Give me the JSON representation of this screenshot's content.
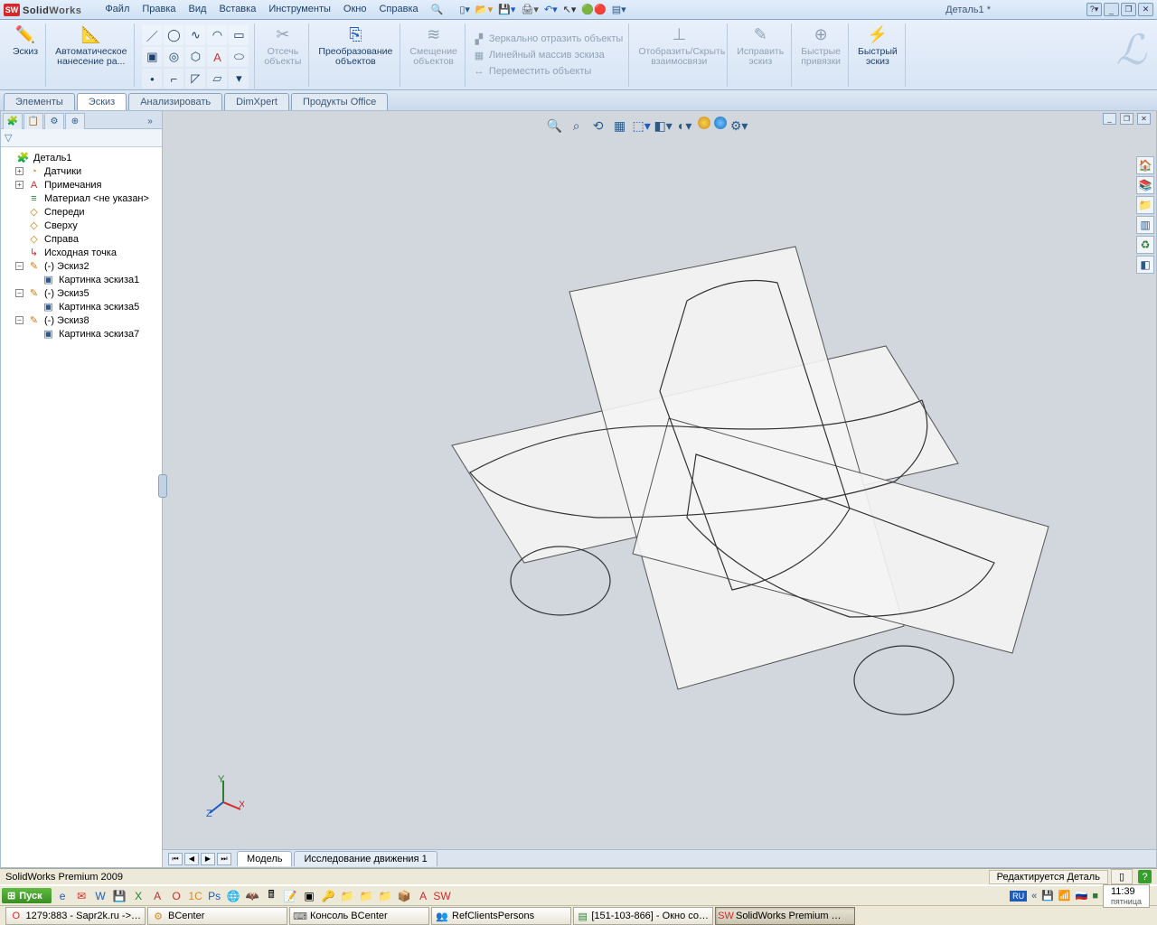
{
  "title": {
    "brand_bold": "Solid",
    "brand_rest": "Works",
    "doc": "Деталь1 *"
  },
  "menubar": [
    "Файл",
    "Правка",
    "Вид",
    "Вставка",
    "Инструменты",
    "Окно",
    "Справка"
  ],
  "ribbon": {
    "sketch": "Эскиз",
    "auto": "Автоматическое\nнанесение ра...",
    "trim": "Отсечь\nобъекты",
    "convert": "Преобразование\nобъектов",
    "offset": "Смещение\nобъектов",
    "mirror": "Зеркально отразить объекты",
    "pattern": "Линейный массив эскиза",
    "move": "Переместить объекты",
    "relations": "Отобразить/Скрыть\nвзаимосвязи",
    "repair": "Исправить\nэскиз",
    "snaps": "Быстрые\nпривязки",
    "rapid": "Быстрый\nэскиз"
  },
  "cmdtabs": [
    "Элементы",
    "Эскиз",
    "Анализировать",
    "DimXpert",
    "Продукты Office"
  ],
  "tree": {
    "root": "Деталь1",
    "items": [
      "Датчики",
      "Примечания",
      "Материал <не указан>",
      "Спереди",
      "Сверху",
      "Справа",
      "Исходная точка"
    ],
    "sketches": [
      {
        "name": "(-) Эскиз2",
        "pic": "Картинка эскиза1"
      },
      {
        "name": "(-) Эскиз5",
        "pic": "Картинка эскиза5"
      },
      {
        "name": "(-) Эскиз8",
        "pic": "Картинка эскиза7"
      }
    ]
  },
  "bottomtabs": {
    "model": "Модель",
    "motion": "Исследование движения 1"
  },
  "status": {
    "product": "SolidWorks Premium 2009",
    "mode": "Редактируется Деталь"
  },
  "taskbar": {
    "start": "Пуск",
    "tasks": [
      "1279:883 - Sapr2k.ru ->…",
      "BCenter",
      "Консоль BCenter",
      "RefClientsPersons",
      "[151-103-866] - Окно со…",
      "SolidWorks Premium …"
    ],
    "lang": "RU",
    "time": "11:39",
    "day": "пятница"
  },
  "colors": {
    "accent": "#2b5a8a",
    "triad_x": "#d62828",
    "triad_y": "#2e7d32",
    "triad_z": "#1e5bbf"
  }
}
